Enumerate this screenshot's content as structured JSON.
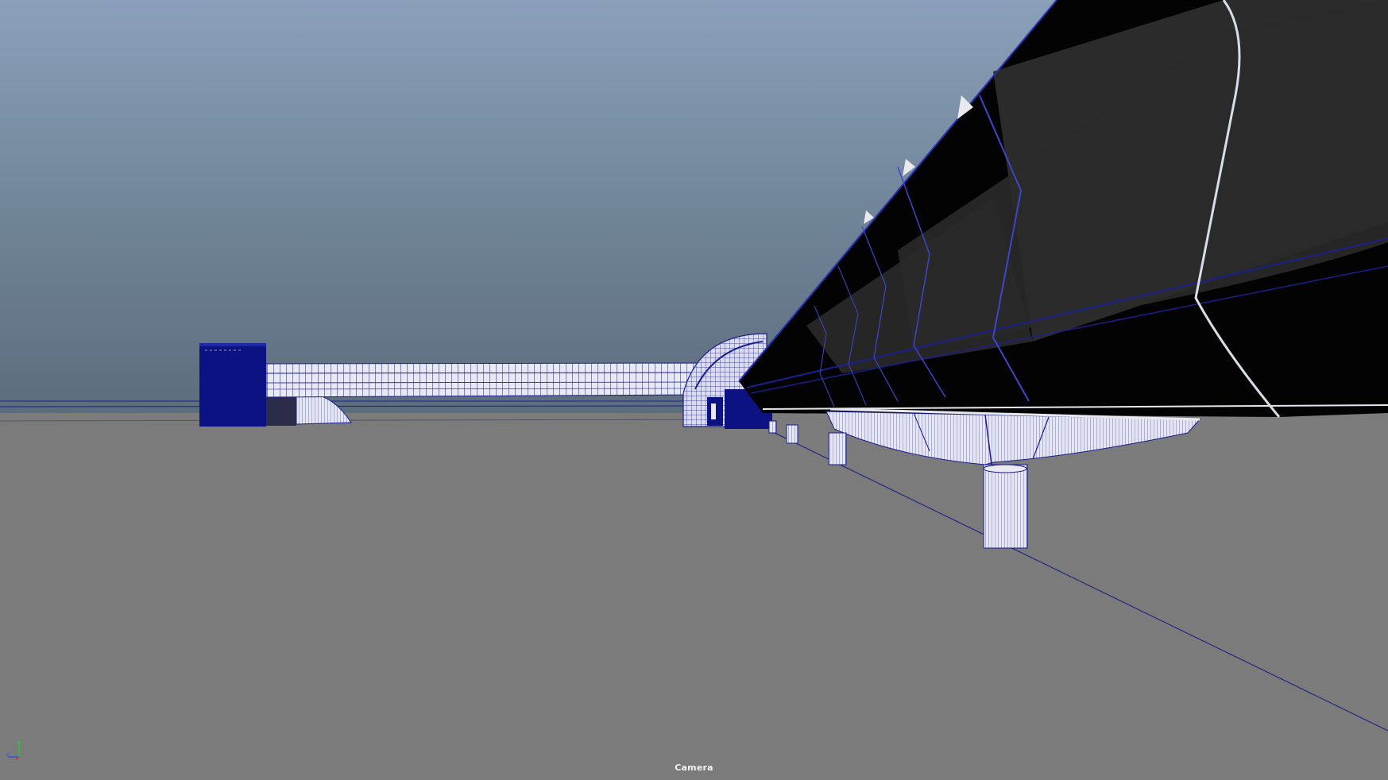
{
  "viewport": {
    "camera_label": "Camera",
    "colors": {
      "sky_top": "#8aa1ba",
      "sky_bottom": "#5c6d7d",
      "ground": "#7b7b7b",
      "wireframe": "#10188a",
      "shaded_dark": "#050505",
      "shaded_panel": "#2a2a2a",
      "surface_light": "#e8e8ee"
    }
  },
  "axis_gizmo": {
    "icon": "xyz-axis-icon",
    "x_color": "#d02020",
    "y_color": "#20c020",
    "z_color": "#2040e0"
  }
}
